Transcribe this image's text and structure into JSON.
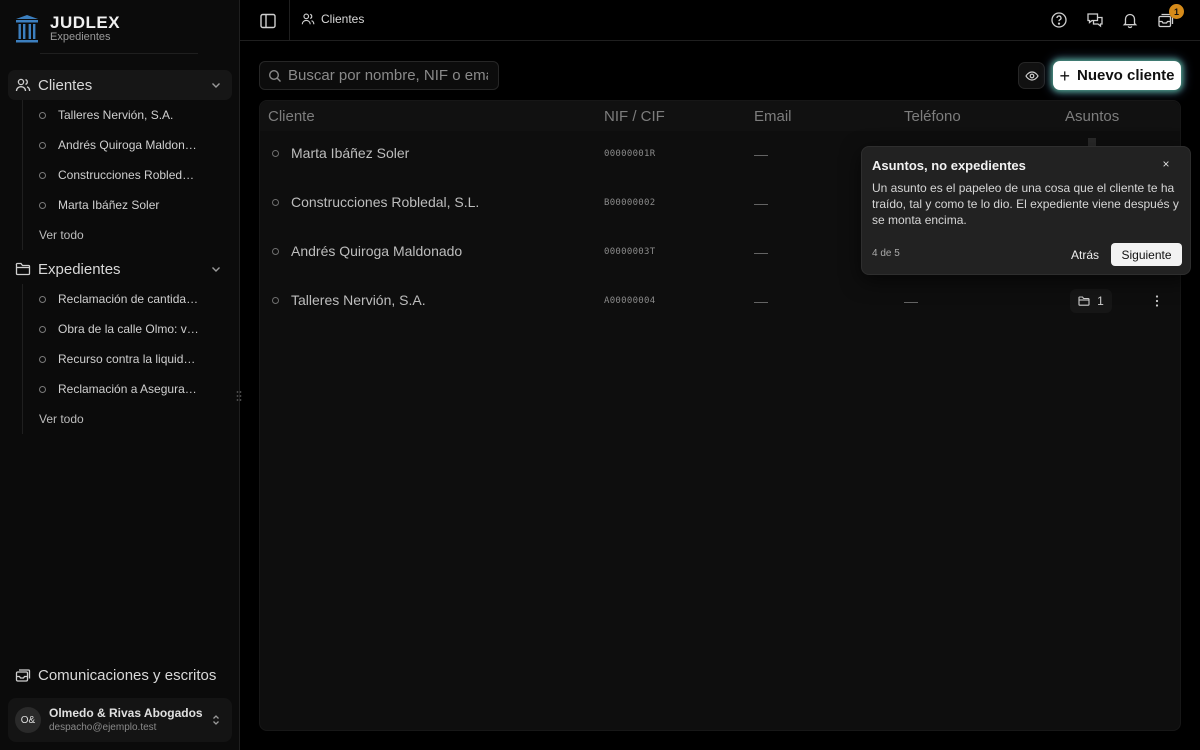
{
  "brand": {
    "name": "JUDLEX",
    "subtitle": "Expedientes",
    "logo_icon": "pillar-icon"
  },
  "sidebar": {
    "clientes": {
      "label": "Clientes",
      "items": [
        "Talleres Nervión, S.A.",
        "Andrés Quiroga Maldonado",
        "Construcciones Robledal, S.L.",
        "Marta Ibáñez Soler"
      ],
      "more": "Ver todo"
    },
    "expedientes": {
      "label": "Expedientes",
      "items": [
        "Reclamación de cantidad a Talleres",
        "Obra de la calle Olmo: vicios ocultos",
        "Recurso contra la liquidación",
        "Reclamación a Aseguradora"
      ],
      "more": "Ver todo"
    },
    "comms": "Comunicaciones y escritos",
    "account": {
      "initials": "O&",
      "name": "Olmedo & Rivas Abogados",
      "email": "despacho@ejemplo.test"
    }
  },
  "topbar": {
    "breadcrumb": "Clientes",
    "icons": [
      "help-icon",
      "messages-icon",
      "bell-icon",
      "inbox-icon"
    ],
    "inbox_badge": "1"
  },
  "toolbar": {
    "search_placeholder": "Buscar por nombre, NIF o email.",
    "new_client_label": "Nuevo cliente"
  },
  "table": {
    "columns": [
      "Cliente",
      "NIF / CIF",
      "Email",
      "Teléfono",
      "Asuntos"
    ],
    "rows": [
      {
        "name": "Marta Ibáñez Soler",
        "nif": "00000001R",
        "email": "—",
        "phone": "",
        "asuntos": ""
      },
      {
        "name": "Construcciones Robledal, S.L.",
        "nif": "B00000002",
        "email": "—",
        "phone": "",
        "asuntos": ""
      },
      {
        "name": "Andrés Quiroga Maldonado",
        "nif": "00000003T",
        "email": "—",
        "phone": "",
        "asuntos": ""
      },
      {
        "name": "Talleres Nervión, S.A.",
        "nif": "A00000004",
        "email": "—",
        "phone": "—",
        "asuntos": "1"
      }
    ]
  },
  "tour": {
    "title": "Asuntos, no expedientes",
    "body": "Un asunto es el papeleo de una cosa que el cliente te ha traído, tal y como te lo dio. El expediente viene después y se monta encima.",
    "step": "4 de 5",
    "back": "Atrás",
    "next": "Siguiente",
    "close": "×"
  },
  "colors": {
    "accent_badge": "#d68b1a",
    "background": "#000000",
    "panel": "#0e0e0e"
  }
}
